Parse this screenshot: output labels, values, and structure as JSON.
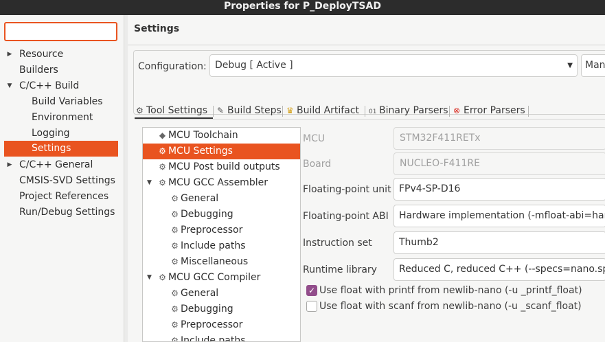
{
  "window": {
    "title": "Properties for P_DeployTSAD"
  },
  "filter": {
    "value": ""
  },
  "nav": {
    "items": [
      {
        "label": "Resource",
        "arrow": "▶"
      },
      {
        "label": "Builders",
        "arrow": ""
      },
      {
        "label": "C/C++ Build",
        "arrow": "▼"
      },
      {
        "label": "Build Variables",
        "arrow": ""
      },
      {
        "label": "Environment",
        "arrow": ""
      },
      {
        "label": "Logging",
        "arrow": ""
      },
      {
        "label": "Settings",
        "arrow": ""
      },
      {
        "label": "C/C++ General",
        "arrow": "▶"
      },
      {
        "label": "CMSIS-SVD Settings",
        "arrow": ""
      },
      {
        "label": "Project References",
        "arrow": ""
      },
      {
        "label": "Run/Debug Settings",
        "arrow": ""
      }
    ]
  },
  "page": {
    "title": "Settings"
  },
  "config": {
    "label": "Configuration:",
    "value": "Debug  [ Active ]",
    "manage_label": "Manage Configurations..."
  },
  "tabs": [
    {
      "label": "Tool Settings",
      "icon": "tool-settings-icon"
    },
    {
      "label": "Build Steps",
      "icon": "build-steps-icon"
    },
    {
      "label": "Build Artifact",
      "icon": "trophy-icon"
    },
    {
      "label": "Binary Parsers",
      "icon": "binary-icon"
    },
    {
      "label": "Error Parsers",
      "icon": "error-icon"
    }
  ],
  "tree": [
    {
      "label": "MCU Toolchain"
    },
    {
      "label": "MCU Settings"
    },
    {
      "label": "MCU Post build outputs"
    },
    {
      "label": "MCU GCC Assembler"
    },
    {
      "label": "General"
    },
    {
      "label": "Debugging"
    },
    {
      "label": "Preprocessor"
    },
    {
      "label": "Include paths"
    },
    {
      "label": "Miscellaneous"
    },
    {
      "label": "MCU GCC Compiler"
    },
    {
      "label": "General"
    },
    {
      "label": "Debugging"
    },
    {
      "label": "Preprocessor"
    },
    {
      "label": "Include paths"
    }
  ],
  "props": {
    "mcu": {
      "label": "MCU",
      "value": "STM32F411RETx"
    },
    "board": {
      "label": "Board",
      "value": "NUCLEO-F411RE"
    },
    "fpu": {
      "label": "Floating-point unit",
      "value": "FPv4-SP-D16"
    },
    "fpabi": {
      "label": "Floating-point ABI",
      "value": "Hardware implementation (-mfloat-abi=hard)"
    },
    "iset": {
      "label": "Instruction set",
      "value": "Thumb2"
    },
    "runtime": {
      "label": "Runtime library",
      "value": "Reduced C, reduced C++ (--specs=nano.specs)"
    }
  },
  "checks": {
    "printf": {
      "label": "Use float with printf from newlib-nano (-u _printf_float)",
      "checked": true
    },
    "scanf": {
      "label": "Use float with scanf from newlib-nano (-u _scanf_float)",
      "checked": false
    }
  },
  "colors": {
    "accent": "#e95420",
    "checkbox": "#924d8b"
  }
}
